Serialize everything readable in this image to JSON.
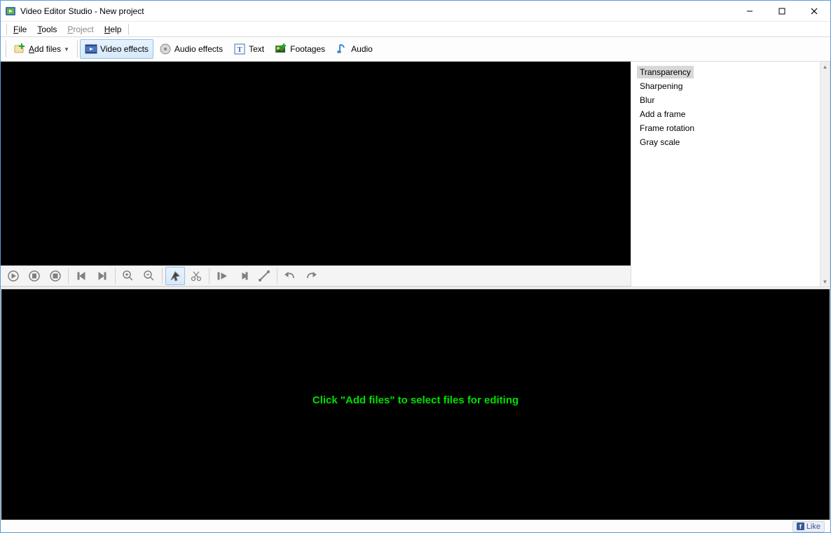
{
  "window": {
    "title": "Video Editor Studio - New project"
  },
  "menu": {
    "file": "File",
    "tools": "Tools",
    "project": "Project",
    "help": "Help"
  },
  "toolbar": {
    "add_files": "Add files",
    "video_effects": "Video effects",
    "audio_effects": "Audio effects",
    "text": "Text",
    "footages": "Footages",
    "audio": "Audio"
  },
  "effects_panel": {
    "items": [
      "Transparency",
      "Sharpening",
      "Blur",
      "Add a frame",
      "Frame rotation",
      "Gray scale"
    ],
    "selected_index": 0
  },
  "timeline": {
    "hint": "Click \"Add files\"  to select files for editing"
  },
  "statusbar": {
    "like_label": "Like"
  }
}
